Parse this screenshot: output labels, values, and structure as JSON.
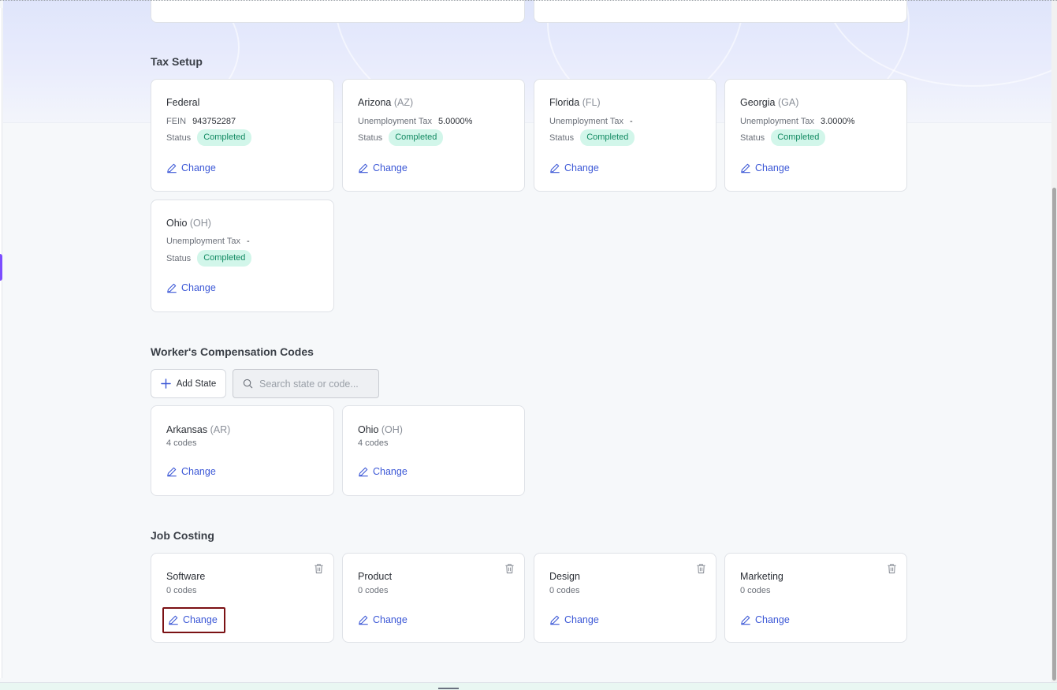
{
  "sections": {
    "tax_setup": "Tax Setup",
    "workers_comp": "Worker's Compensation Codes",
    "job_costing": "Job Costing"
  },
  "tax_cards": [
    {
      "name": "Federal",
      "abbr": "",
      "field_label": "FEIN",
      "field_value": "943752287",
      "status_label": "Status",
      "status": "Completed",
      "change": "Change"
    },
    {
      "name": "Arizona",
      "abbr": "(AZ)",
      "field_label": "Unemployment Tax",
      "field_value": "5.0000%",
      "status_label": "Status",
      "status": "Completed",
      "change": "Change"
    },
    {
      "name": "Florida",
      "abbr": "(FL)",
      "field_label": "Unemployment Tax",
      "field_value": "-",
      "status_label": "Status",
      "status": "Completed",
      "change": "Change"
    },
    {
      "name": "Georgia",
      "abbr": "(GA)",
      "field_label": "Unemployment Tax",
      "field_value": "3.0000%",
      "status_label": "Status",
      "status": "Completed",
      "change": "Change"
    },
    {
      "name": "Ohio",
      "abbr": "(OH)",
      "field_label": "Unemployment Tax",
      "field_value": "-",
      "status_label": "Status",
      "status": "Completed",
      "change": "Change"
    }
  ],
  "workers_comp": {
    "add_state": "Add State",
    "search_placeholder": "Search state or code...",
    "cards": [
      {
        "name": "Arkansas",
        "abbr": "(AR)",
        "codes": "4 codes",
        "change": "Change"
      },
      {
        "name": "Ohio",
        "abbr": "(OH)",
        "codes": "4 codes",
        "change": "Change"
      }
    ]
  },
  "job_costing": {
    "cards": [
      {
        "name": "Software",
        "codes": "0 codes",
        "change": "Change"
      },
      {
        "name": "Product",
        "codes": "0 codes",
        "change": "Change"
      },
      {
        "name": "Design",
        "codes": "0 codes",
        "change": "Change"
      },
      {
        "name": "Marketing",
        "codes": "0 codes",
        "change": "Change"
      }
    ]
  },
  "colors": {
    "accent": "#3b57d6",
    "badge_bg": "#d2f6ea",
    "badge_text": "#128a62",
    "focus_outline": "#7b1114",
    "side_marker": "#7c4dff"
  },
  "icons": [
    "pencil-icon",
    "trash-icon",
    "plus-icon",
    "search-icon"
  ]
}
